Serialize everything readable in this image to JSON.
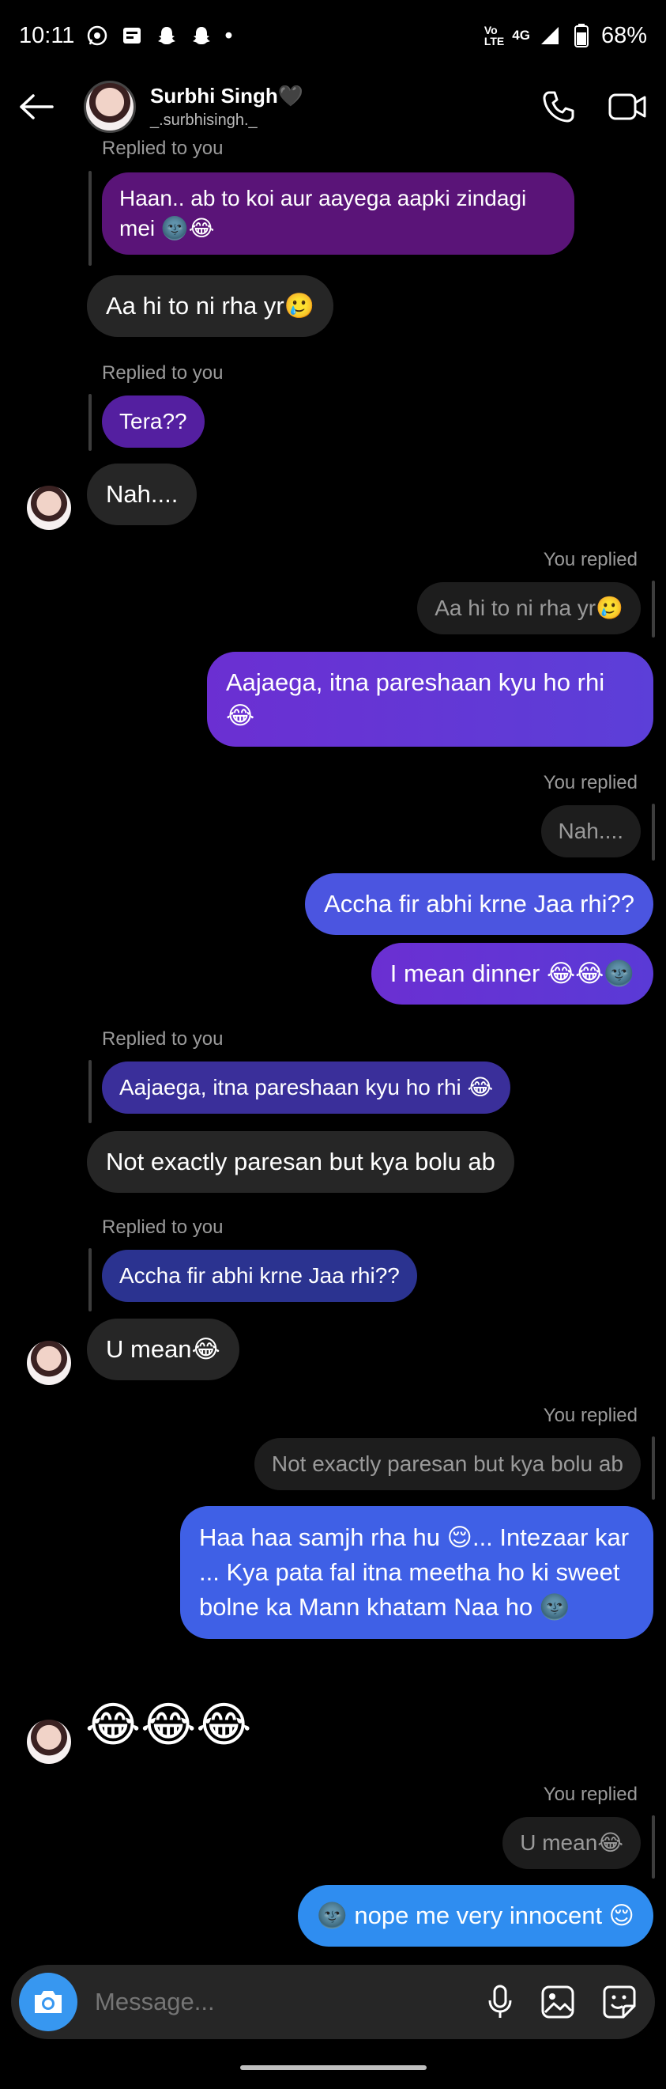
{
  "status_bar": {
    "time": "10:11",
    "dot": "•",
    "network": "4G",
    "battery": "68%"
  },
  "header": {
    "name": "Surbhi Singh🖤",
    "username": "_.surbhisingh._"
  },
  "messages": {
    "m1_label": "Replied to you",
    "m1_quote": "Haan.. ab to koi aur aayega aapki zindagi mei 🌚😂",
    "m1_text": "Aa hi to ni rha yr🥲",
    "m2_label": "Replied to you",
    "m2_quote": "Tera??",
    "m2_text": "Nah....",
    "m3_label": "You replied",
    "m3_quote": "Aa hi to ni rha yr🥲",
    "m3_text": "Aajaega, itna pareshaan kyu ho rhi 😂",
    "m4_label": "You replied",
    "m4_quote": "Nah....",
    "m4_text1": "Accha fir abhi krne Jaa rhi??",
    "m4_text2": "I mean dinner 😂😂🌚",
    "m5_label": "Replied to you",
    "m5_quote": "Aajaega, itna pareshaan kyu ho rhi 😂",
    "m5_text": "Not exactly paresan but kya bolu ab",
    "m6_label": "Replied to you",
    "m6_quote": "Accha fir abhi krne Jaa rhi??",
    "m6_text": "U mean😂",
    "m7_label": "You replied",
    "m7_quote": "Not exactly paresan but kya bolu ab",
    "m7_text": "Haa haa samjh rha hu 😌... Intezaar kar ... Kya pata fal itna meetha ho ki sweet bolne ka Mann khatam Naa ho 🌚",
    "m8_emojis": "😂😂😂",
    "m9_label": "You replied",
    "m9_quote": "U mean😂",
    "m9_text": "🌚 nope me very innocent 😌"
  },
  "composer": {
    "placeholder": "Message..."
  },
  "colors": {
    "purple_dark": "#5a1478",
    "purple_mid": "#6b2fd2",
    "indigo": "#4b55e0",
    "blue": "#2f8df0",
    "gray": "#262626"
  },
  "icons": [
    "whatsapp-icon",
    "news-icon",
    "snapchat-icon",
    "snapchat-icon",
    "signal-icon",
    "battery-icon",
    "back-arrow-icon",
    "phone-icon",
    "video-icon",
    "camera-icon",
    "mic-icon",
    "gallery-icon",
    "sticker-icon"
  ]
}
